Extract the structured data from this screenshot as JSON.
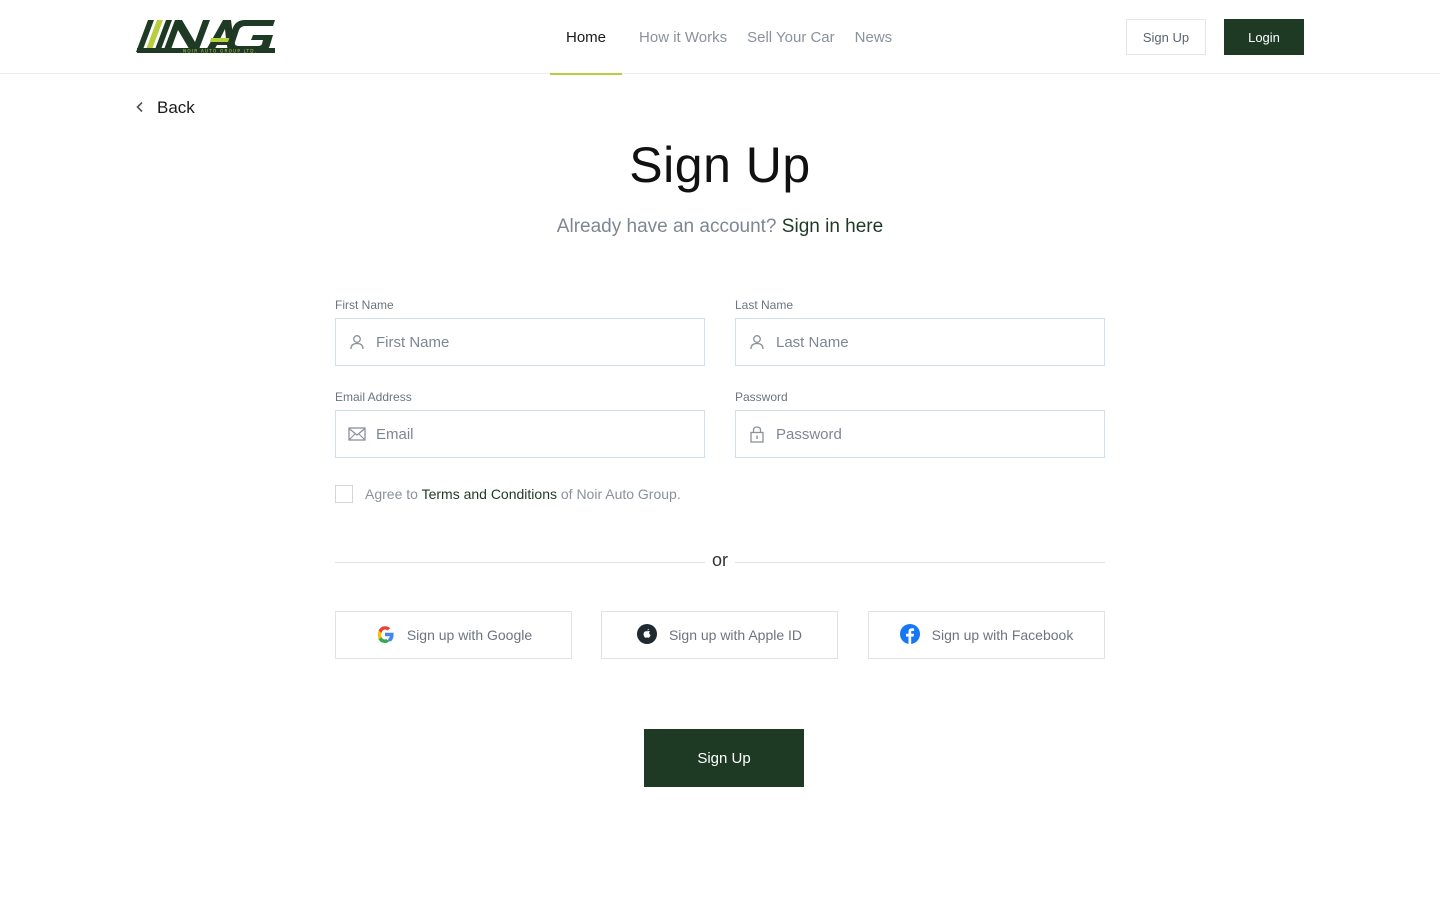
{
  "brand": {
    "name": "NAG",
    "tagline": "NOIR AUTO GROUP LTD.",
    "colors": {
      "primary": "#1f3a24",
      "accent": "#b5cf3f"
    }
  },
  "nav": {
    "items": [
      {
        "label": "Home",
        "active": true
      },
      {
        "label": "How it Works",
        "active": false
      },
      {
        "label": "Sell Your Car",
        "active": false
      },
      {
        "label": "News",
        "active": false
      }
    ]
  },
  "header": {
    "signup_label": "Sign Up",
    "login_label": "Login"
  },
  "back": {
    "label": "Back",
    "icon": "chevron-left-icon"
  },
  "page": {
    "title": "Sign Up",
    "subtitle": "Already have an account?",
    "signin_link": "Sign in here"
  },
  "form": {
    "first_name": {
      "label": "First Name",
      "placeholder": "First Name",
      "icon": "user-icon"
    },
    "last_name": {
      "label": "Last Name",
      "placeholder": "Last Name",
      "icon": "user-icon"
    },
    "email": {
      "label": "Email Address",
      "placeholder": "Email",
      "icon": "envelope-icon"
    },
    "password": {
      "label": "Password",
      "placeholder": "Password",
      "icon": "lock-icon"
    },
    "agree": {
      "prefix": "Agree to",
      "terms": "Terms and Conditions",
      "suffix": "of Noir Auto Group.",
      "checked": false
    }
  },
  "divider": {
    "label": "or"
  },
  "social": {
    "google": "Sign up with Google",
    "apple": "Sign up with Apple ID",
    "facebook": "Sign up with Facebook"
  },
  "submit": {
    "label": "Sign Up"
  }
}
